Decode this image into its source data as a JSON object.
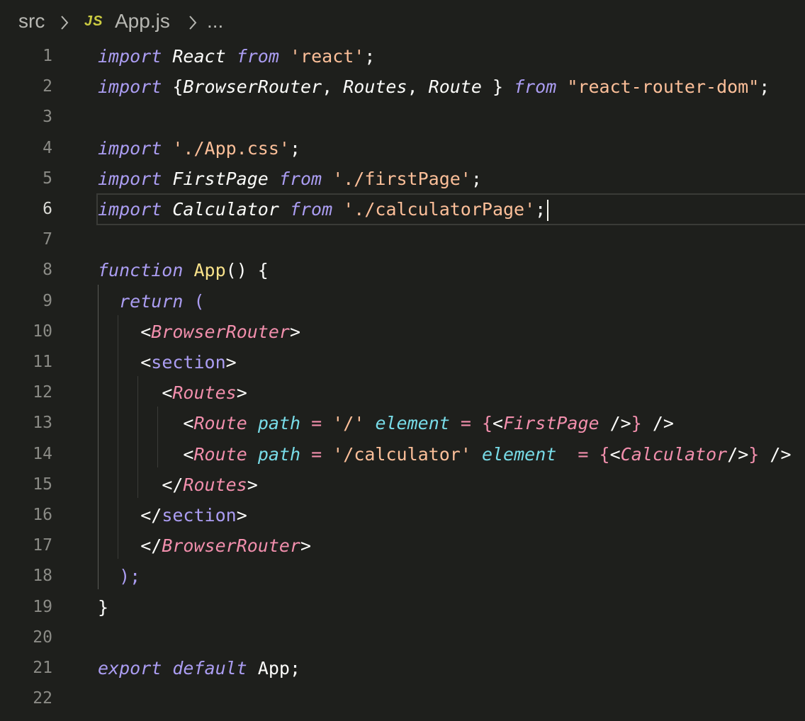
{
  "breadcrumb": {
    "folder": "src",
    "file_icon": "JS",
    "file": "App.js",
    "more": "..."
  },
  "editor": {
    "current_line": 6,
    "line_numbers": [
      "1",
      "2",
      "3",
      "4",
      "5",
      "6",
      "7",
      "8",
      "9",
      "10",
      "11",
      "12",
      "13",
      "14",
      "15",
      "16",
      "17",
      "18",
      "19",
      "20",
      "21",
      "22"
    ],
    "lines": [
      [
        {
          "t": "import",
          "c": "kw"
        },
        {
          "t": " "
        },
        {
          "t": "React",
          "c": "ital"
        },
        {
          "t": " "
        },
        {
          "t": "from",
          "c": "kw"
        },
        {
          "t": " "
        },
        {
          "t": "'react'",
          "c": "str"
        },
        {
          "t": ";",
          "c": "pun"
        }
      ],
      [
        {
          "t": "import",
          "c": "kw"
        },
        {
          "t": " "
        },
        {
          "t": "{",
          "c": "pun"
        },
        {
          "t": "BrowserRouter",
          "c": "ital"
        },
        {
          "t": ", ",
          "c": "pun"
        },
        {
          "t": "Routes",
          "c": "ital"
        },
        {
          "t": ", ",
          "c": "pun"
        },
        {
          "t": "Route",
          "c": "ital"
        },
        {
          "t": " }",
          "c": "pun"
        },
        {
          "t": " "
        },
        {
          "t": "from",
          "c": "kw"
        },
        {
          "t": " "
        },
        {
          "t": "\"react-router-dom\"",
          "c": "str"
        },
        {
          "t": ";",
          "c": "pun"
        }
      ],
      [],
      [
        {
          "t": "import",
          "c": "kw"
        },
        {
          "t": " "
        },
        {
          "t": "'./App.css'",
          "c": "str"
        },
        {
          "t": ";",
          "c": "pun"
        }
      ],
      [
        {
          "t": "import",
          "c": "kw"
        },
        {
          "t": " "
        },
        {
          "t": "FirstPage",
          "c": "ital"
        },
        {
          "t": " "
        },
        {
          "t": "from",
          "c": "kw"
        },
        {
          "t": " "
        },
        {
          "t": "'./firstPage'",
          "c": "str"
        },
        {
          "t": ";",
          "c": "pun"
        }
      ],
      [
        {
          "t": "import",
          "c": "kw"
        },
        {
          "t": " "
        },
        {
          "t": "Calculator",
          "c": "ital"
        },
        {
          "t": " "
        },
        {
          "t": "from",
          "c": "kw"
        },
        {
          "t": " "
        },
        {
          "t": "'./calculatorPage'",
          "c": "str"
        },
        {
          "t": ";",
          "c": "pun"
        }
      ],
      [],
      [
        {
          "t": "function",
          "c": "kw"
        },
        {
          "t": " "
        },
        {
          "t": "App",
          "c": "fn"
        },
        {
          "t": "() {",
          "c": "pun"
        }
      ],
      [
        {
          "t": "  "
        },
        {
          "t": "return",
          "c": "kw"
        },
        {
          "t": " "
        },
        {
          "t": "(",
          "c": "dim"
        }
      ],
      [
        {
          "t": "    "
        },
        {
          "t": "<",
          "c": "pun"
        },
        {
          "t": "BrowserRouter",
          "c": "tag"
        },
        {
          "t": ">",
          "c": "pun"
        }
      ],
      [
        {
          "t": "    "
        },
        {
          "t": "<",
          "c": "pun"
        },
        {
          "t": "section",
          "c": "html"
        },
        {
          "t": ">",
          "c": "pun"
        }
      ],
      [
        {
          "t": "      "
        },
        {
          "t": "<",
          "c": "pun"
        },
        {
          "t": "Routes",
          "c": "tag"
        },
        {
          "t": ">",
          "c": "pun"
        }
      ],
      [
        {
          "t": "        "
        },
        {
          "t": "<",
          "c": "pun"
        },
        {
          "t": "Route",
          "c": "tag"
        },
        {
          "t": " "
        },
        {
          "t": "path",
          "c": "attr"
        },
        {
          "t": " "
        },
        {
          "t": "=",
          "c": "op"
        },
        {
          "t": " "
        },
        {
          "t": "'/'",
          "c": "str"
        },
        {
          "t": " "
        },
        {
          "t": "element",
          "c": "attr"
        },
        {
          "t": " "
        },
        {
          "t": "=",
          "c": "op"
        },
        {
          "t": " "
        },
        {
          "t": "{",
          "c": "brace"
        },
        {
          "t": "<",
          "c": "pun"
        },
        {
          "t": "FirstPage",
          "c": "tag"
        },
        {
          "t": " />",
          "c": "pun"
        },
        {
          "t": "}",
          "c": "brace"
        },
        {
          "t": " />",
          "c": "pun"
        }
      ],
      [
        {
          "t": "        "
        },
        {
          "t": "<",
          "c": "pun"
        },
        {
          "t": "Route",
          "c": "tag"
        },
        {
          "t": " "
        },
        {
          "t": "path",
          "c": "attr"
        },
        {
          "t": " "
        },
        {
          "t": "=",
          "c": "op"
        },
        {
          "t": " "
        },
        {
          "t": "'/calculator'",
          "c": "str"
        },
        {
          "t": " "
        },
        {
          "t": "element",
          "c": "attr"
        },
        {
          "t": "  "
        },
        {
          "t": "=",
          "c": "op"
        },
        {
          "t": " "
        },
        {
          "t": "{",
          "c": "brace"
        },
        {
          "t": "<",
          "c": "pun"
        },
        {
          "t": "Calculator",
          "c": "tag"
        },
        {
          "t": "/>",
          "c": "pun"
        },
        {
          "t": "}",
          "c": "brace"
        },
        {
          "t": " />",
          "c": "pun"
        }
      ],
      [
        {
          "t": "      "
        },
        {
          "t": "</",
          "c": "pun"
        },
        {
          "t": "Routes",
          "c": "tag"
        },
        {
          "t": ">",
          "c": "pun"
        }
      ],
      [
        {
          "t": "    "
        },
        {
          "t": "</",
          "c": "pun"
        },
        {
          "t": "section",
          "c": "html"
        },
        {
          "t": ">",
          "c": "pun"
        }
      ],
      [
        {
          "t": "    "
        },
        {
          "t": "</",
          "c": "pun"
        },
        {
          "t": "BrowserRouter",
          "c": "tag"
        },
        {
          "t": ">",
          "c": "pun"
        }
      ],
      [
        {
          "t": "  "
        },
        {
          "t": ");",
          "c": "dim"
        }
      ],
      [
        {
          "t": "}",
          "c": "pun"
        }
      ],
      [],
      [
        {
          "t": "export",
          "c": "kw"
        },
        {
          "t": " "
        },
        {
          "t": "default",
          "c": "kw"
        },
        {
          "t": " "
        },
        {
          "t": "App",
          "c": "pun"
        },
        {
          "t": ";",
          "c": "pun"
        }
      ],
      []
    ]
  },
  "colors": {
    "background": "#1e1f1c",
    "keyword": "#ab9df2",
    "string": "#fcbf99",
    "function": "#f9e28a",
    "component_tag": "#f28fad",
    "attribute": "#78dce8",
    "line_number": "#8b8b86"
  }
}
